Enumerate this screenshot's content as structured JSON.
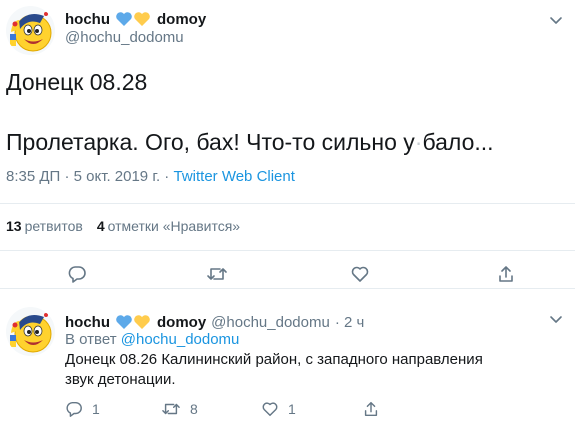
{
  "main_tweet": {
    "author_name": "hochu",
    "author_name_suffix": "domoy",
    "handle": "@hochu_dodomu",
    "text_line1": "Донецк 08.28",
    "text_line2": "Пролетарка. Ого, бах! Что-то сильно у",
    "text_line2_end": "бало...",
    "time": "8:35 ДП",
    "separator": " · ",
    "date": "5 окт. 2019 г.",
    "client": "Twitter Web Client",
    "retweets_count": "13",
    "retweets_label": "ретвитов",
    "likes_count": "4",
    "likes_label": "отметки «Нравится»"
  },
  "reply_tweet": {
    "author_name": "hochu",
    "author_name_suffix": "domoy",
    "handle": "@hochu_dodomu",
    "age": "· 2 ч",
    "reply_prefix": "В ответ",
    "reply_mention": "@hochu_dodomu",
    "text": "Донецк 08.26 Калининский район, с западного направления звук детонации.",
    "reply_count": "1",
    "retweet_count": "8",
    "like_count": "1"
  },
  "icons": {
    "reply": "reply-icon",
    "retweet": "retweet-icon",
    "like": "heart-icon",
    "share": "share-icon",
    "more": "chevron-down-icon",
    "avatar": "avatar-smiley"
  },
  "colors": {
    "text": "#14171a",
    "secondary": "#657786",
    "link": "#1b95e0",
    "divider": "#e6ecf0",
    "heart_blue": "#5da9e9",
    "heart_yellow": "#ffcc4d"
  }
}
